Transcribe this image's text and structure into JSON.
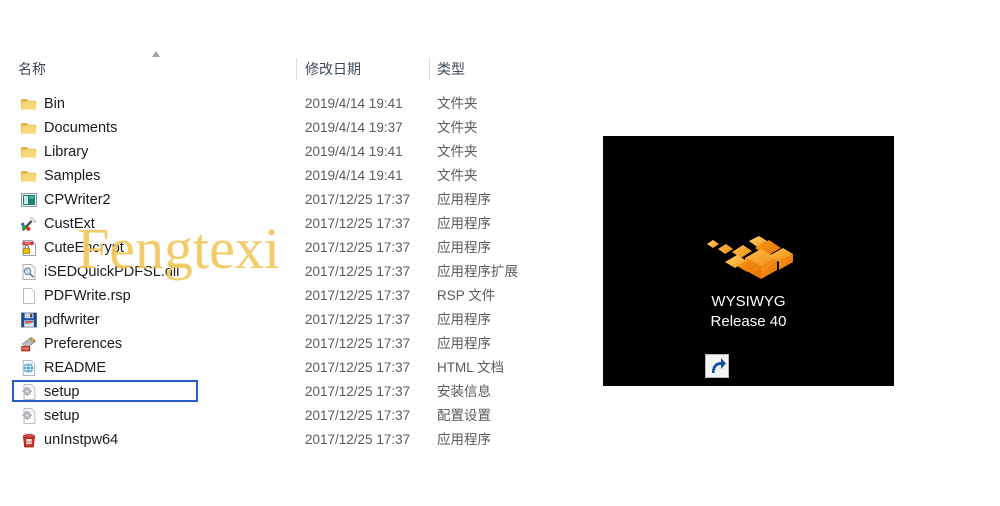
{
  "explorer": {
    "columns": {
      "name": "名称",
      "date_modified": "修改日期",
      "type": "类型"
    },
    "sort": {
      "column": "名称",
      "direction": "ascending",
      "icon": "sort-ascending-arrow-icon"
    },
    "rows": [
      {
        "name": "Bin",
        "date": "2019/4/14 19:41",
        "type": "文件夹",
        "icon": "folder-icon",
        "selected": false
      },
      {
        "name": "Documents",
        "date": "2019/4/14 19:37",
        "type": "文件夹",
        "icon": "folder-icon",
        "selected": false
      },
      {
        "name": "Library",
        "date": "2019/4/14 19:41",
        "type": "文件夹",
        "icon": "folder-icon",
        "selected": false
      },
      {
        "name": "Samples",
        "date": "2019/4/14 19:41",
        "type": "文件夹",
        "icon": "folder-icon",
        "selected": false
      },
      {
        "name": "CPWriter2",
        "date": "2017/12/25 17:37",
        "type": "应用程序",
        "icon": "application-window-icon",
        "selected": false
      },
      {
        "name": "CustExt",
        "date": "2017/12/25 17:37",
        "type": "应用程序",
        "icon": "magic-wand-icon",
        "selected": false
      },
      {
        "name": "CuteEncrypt",
        "date": "2017/12/25 17:37",
        "type": "应用程序",
        "icon": "pdf-lock-icon",
        "selected": false
      },
      {
        "name": "iSEDQuickPDFSL.dll",
        "date": "2017/12/25 17:37",
        "type": "应用程序扩展",
        "icon": "dll-document-icon",
        "selected": false
      },
      {
        "name": "PDFWrite.rsp",
        "date": "2017/12/25 17:37",
        "type": "RSP 文件",
        "icon": "blank-document-icon",
        "selected": false
      },
      {
        "name": "pdfwriter",
        "date": "2017/12/25 17:37",
        "type": "应用程序",
        "icon": "floppy-disk-icon",
        "selected": false
      },
      {
        "name": "Preferences",
        "date": "2017/12/25 17:37",
        "type": "应用程序",
        "icon": "preferences-tools-icon",
        "selected": false
      },
      {
        "name": "README",
        "date": "2017/12/25 17:37",
        "type": "HTML 文档",
        "icon": "browser-globe-icon",
        "selected": false
      },
      {
        "name": "setup",
        "date": "2017/12/25 17:37",
        "type": "安装信息",
        "icon": "gear-document-icon",
        "selected": true
      },
      {
        "name": "setup",
        "date": "2017/12/25 17:37",
        "type": "配置设置",
        "icon": "gear-document-icon",
        "selected": false
      },
      {
        "name": "unInstpw64",
        "date": "2017/12/25 17:37",
        "type": "应用程序",
        "icon": "uninstall-bin-icon",
        "selected": false
      }
    ],
    "selection_color": "#2a5cc8"
  },
  "watermark": {
    "text": "Fengtexi",
    "color": "#f2c75c"
  },
  "desktop_panel": {
    "background": "#000000",
    "shortcut": {
      "logo_icon": "wysiwyg-orange-cubes-logo",
      "badge_icon": "shortcut-arrow-icon",
      "label_line1": "WYSIWYG",
      "label_line2": "Release 40",
      "label_color": "#ffffff"
    }
  }
}
